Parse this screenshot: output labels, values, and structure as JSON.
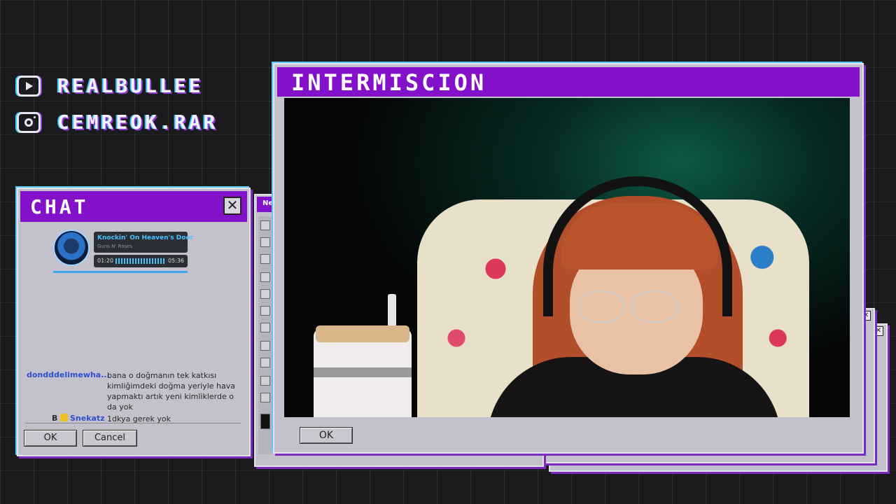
{
  "socials": [
    {
      "icon": "youtube-icon",
      "handle": "REALBULLEE"
    },
    {
      "icon": "instagram-icon",
      "handle": "CEMREOK.RAR"
    }
  ],
  "chat_window": {
    "title": "CHAT",
    "close_label": "✕",
    "now_playing": {
      "song": "Knockin' On Heaven's Door",
      "artist": "Guns N' Roses",
      "elapsed": "01:20",
      "duration": "05:36"
    },
    "messages": [
      {
        "user": "dondddelimewha...",
        "text": "bana o doğmanın tek katkısı kimliğimdeki doğma yeriyle hava yapmaktı artık yeni kimliklerde o da yok"
      },
      {
        "user": "Snekatz",
        "badge": "B",
        "text": "1dkya gerek yok"
      }
    ],
    "ok_label": "OK",
    "cancel_label": "Cancel"
  },
  "paint_window": {
    "title": "Ne"
  },
  "intermission_window": {
    "title": "INTERMISCION",
    "ok_label": "OK"
  },
  "colors": {
    "titlebar": "#8311c9",
    "window_bg": "#c3c1cb",
    "background": "#1b1b1d"
  }
}
